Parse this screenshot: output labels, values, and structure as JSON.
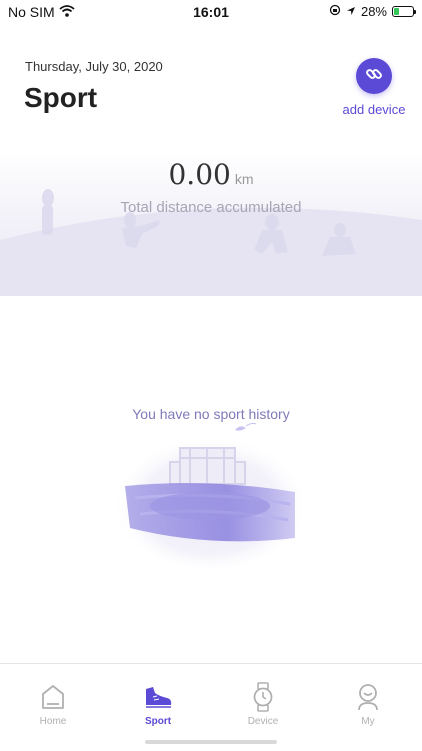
{
  "status_bar": {
    "carrier": "No SIM",
    "time": "16:01",
    "battery_percent": "28%",
    "battery_level": 0.28
  },
  "header": {
    "date": "Thursday, July 30, 2020",
    "title": "Sport",
    "add_device_label": "add device"
  },
  "summary": {
    "distance_value": "0.00",
    "distance_unit": "km",
    "caption": "Total distance accumulated"
  },
  "empty_state": {
    "message": "You have no sport history"
  },
  "tabs": [
    {
      "label": "Home",
      "icon": "home-icon",
      "active": false
    },
    {
      "label": "Sport",
      "icon": "sneaker-icon",
      "active": true
    },
    {
      "label": "Device",
      "icon": "watch-icon",
      "active": false
    },
    {
      "label": "My",
      "icon": "profile-icon",
      "active": false
    }
  ],
  "colors": {
    "accent": "#5b4ad6",
    "inactive": "#b0b0b0",
    "battery": "#34c759"
  }
}
